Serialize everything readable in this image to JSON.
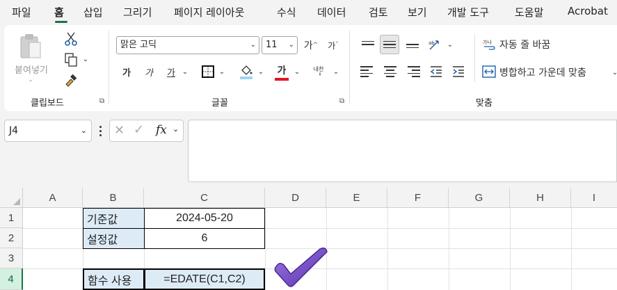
{
  "menu": {
    "tabs": [
      "파일",
      "홈",
      "삽입",
      "그리기",
      "페이지 레이아웃",
      "수식",
      "데이터",
      "검토",
      "보기",
      "개발 도구",
      "도움말",
      "Acrobat"
    ],
    "active_tab": "홈"
  },
  "ribbon": {
    "clipboard": {
      "paste_label": "붙여넣기",
      "group_label": "클립보드"
    },
    "font": {
      "font_name": "맑은 고딕",
      "font_size": "11",
      "increase_label": "가",
      "decrease_label": "가",
      "bold_label": "가",
      "italic_label": "가",
      "underline_label": "가",
      "font_color_label": "가",
      "phonetic_label": "내천",
      "group_label": "글꼴",
      "font_color": "#e81123",
      "fill_color": "#9fd5f0"
    },
    "alignment": {
      "wrap_text_label": "자동 줄 바꿈",
      "merge_center_label": "병합하고 가운데 맞춤",
      "group_label": "맞춤"
    }
  },
  "formula_bar": {
    "name_box": "J4",
    "fx_label": "fx",
    "formula": ""
  },
  "sheet": {
    "columns": [
      "A",
      "B",
      "C",
      "D",
      "E",
      "F",
      "G",
      "H",
      "I"
    ],
    "rows": [
      "1",
      "2",
      "3",
      "4"
    ],
    "cells": {
      "B1": "기준값",
      "C1": "2024-05-20",
      "B2": "설정값",
      "C2": "6",
      "B4": "함수 사용",
      "C4": "=EDATE(C1,C2)"
    },
    "accent_color": "#107c41",
    "cell_fill": "#ddebf7",
    "checkmark_color": "#6b3fc2"
  }
}
